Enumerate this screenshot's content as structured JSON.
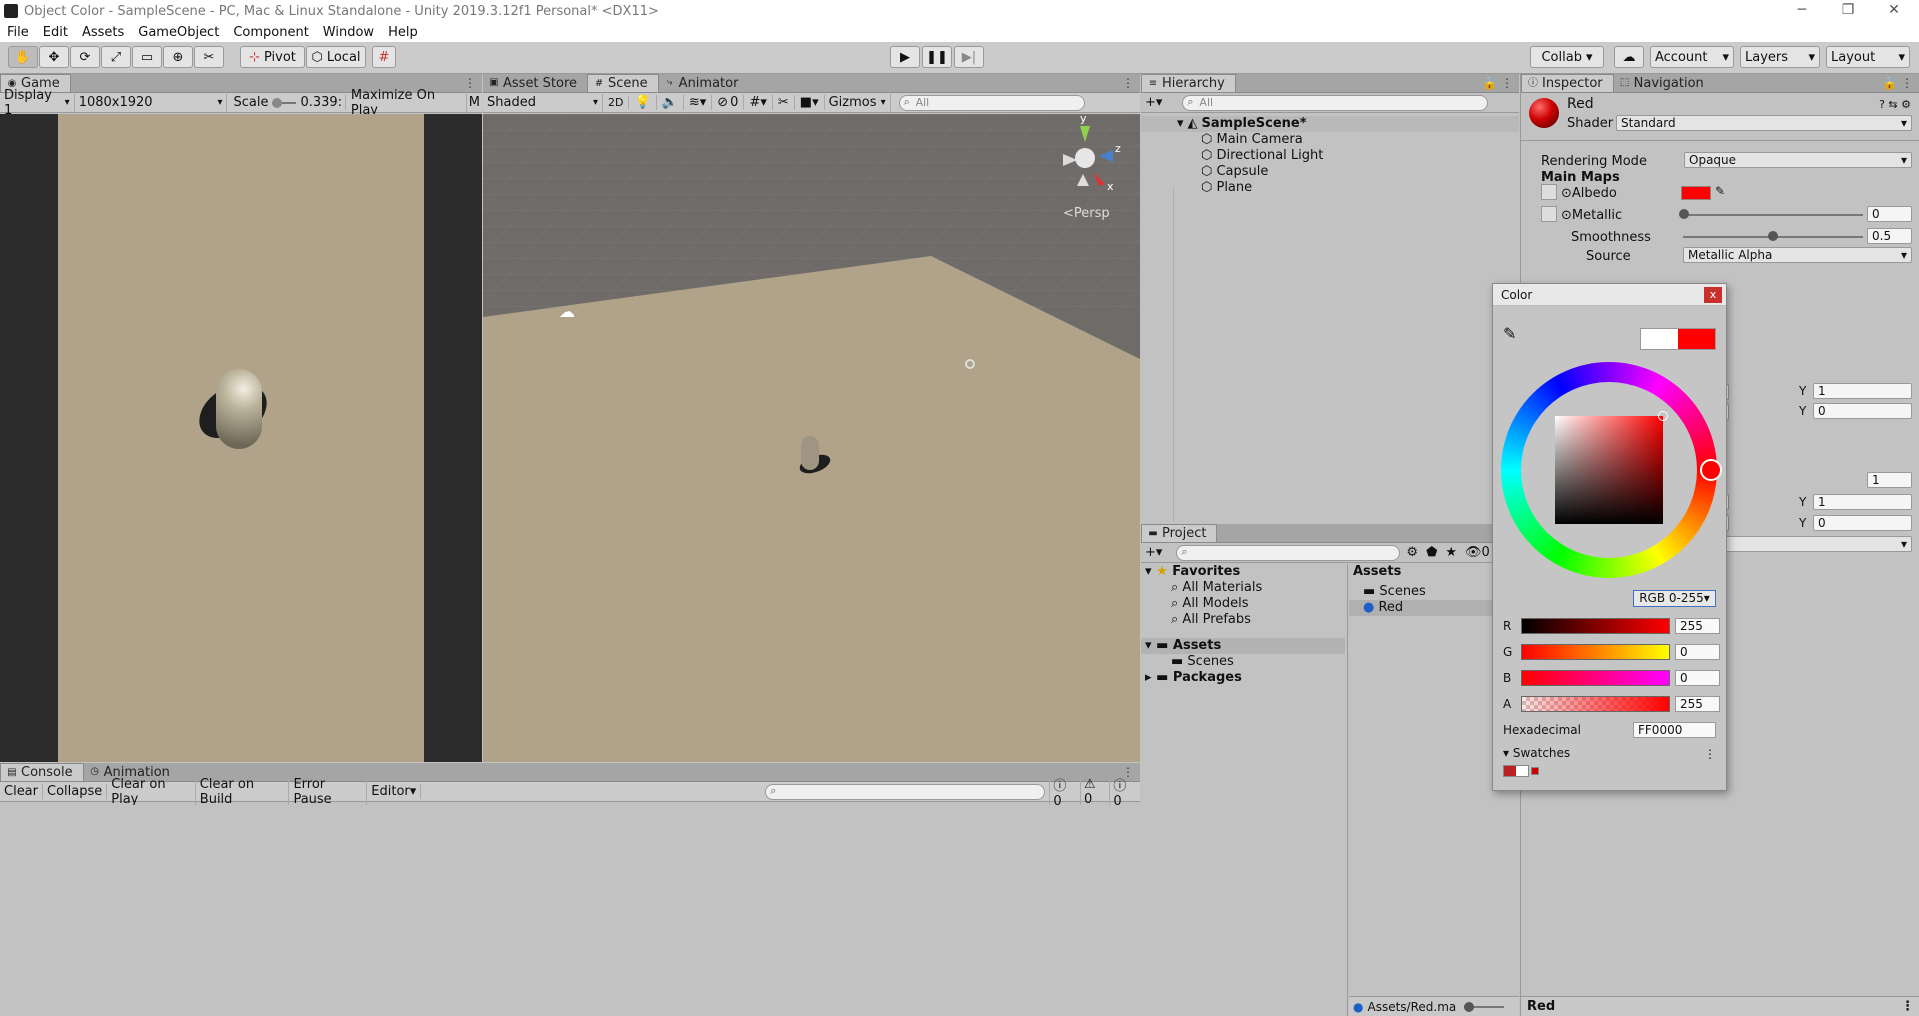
{
  "window": {
    "title": "Object Color - SampleScene - PC, Mac & Linux Standalone - Unity 2019.3.12f1 Personal* <DX11>"
  },
  "menu": [
    "File",
    "Edit",
    "Assets",
    "GameObject",
    "Component",
    "Window",
    "Help"
  ],
  "toolbar": {
    "pivot": "Pivot",
    "local": "Local",
    "collab": "Collab",
    "account": "Account",
    "layers": "Layers",
    "layout": "Layout"
  },
  "game": {
    "tab": "Game",
    "display": "Display 1",
    "resolution": "1080x1920",
    "scale_label": "Scale",
    "scale_value": "0.339:",
    "maximize": "Maximize On Play",
    "extra": "M"
  },
  "scene": {
    "tabs": [
      "Asset Store",
      "Scene",
      "Animator"
    ],
    "shading": "Shaded",
    "mode2d": "2D",
    "hidden_count": "0",
    "gizmos": "Gizmos",
    "search": "All",
    "persp": "Persp",
    "axis": {
      "x": "x",
      "y": "y",
      "z": "z"
    }
  },
  "hierarchy": {
    "tab": "Hierarchy",
    "search": "All",
    "scene": "SampleScene*",
    "items": [
      "Main Camera",
      "Directional Light",
      "Capsule",
      "Plane"
    ]
  },
  "project": {
    "tab": "Project",
    "favorites": "Favorites",
    "fav_items": [
      "All Materials",
      "All Models",
      "All Prefabs"
    ],
    "assets": "Assets",
    "asset_folders": [
      "Scenes"
    ],
    "packages": "Packages",
    "grid_header": "Assets",
    "grid_items": [
      "Scenes",
      "Red"
    ],
    "status_path": "Assets/Red.ma"
  },
  "console": {
    "tabs": [
      "Console",
      "Animation"
    ],
    "buttons": [
      "Clear",
      "Collapse",
      "Clear on Play",
      "Clear on Build",
      "Error Pause",
      "Editor"
    ],
    "counts": [
      "0",
      "0",
      "0"
    ]
  },
  "inspector": {
    "tabs": [
      "Inspector",
      "Navigation"
    ],
    "name": "Red",
    "shader_label": "Shader",
    "shader": "Standard",
    "rendering_mode_label": "Rendering Mode",
    "rendering_mode": "Opaque",
    "main_maps": "Main Maps",
    "albedo": "Albedo",
    "metallic": "Metallic",
    "metallic_value": "0",
    "smoothness": "Smoothness",
    "smoothness_value": "0.5",
    "source": "Source",
    "source_value": "Metallic Alpha",
    "y1": "Y",
    "y1v": "1",
    "y2": "Y",
    "y2v": "0",
    "field_val": "1",
    "y3": "Y",
    "y3v": "1",
    "y4": "Y",
    "y4v": "0",
    "footer": "Red"
  },
  "color_picker": {
    "title": "Color",
    "close": "x",
    "mode": "RGB 0-255",
    "r_label": "R",
    "r": "255",
    "g_label": "G",
    "g": "0",
    "b_label": "B",
    "b": "0",
    "a_label": "A",
    "a": "255",
    "hex_label": "Hexadecimal",
    "hex": "FF0000",
    "swatches": "Swatches",
    "current_color": "#ff0000",
    "previous_color": "#ffffff"
  }
}
